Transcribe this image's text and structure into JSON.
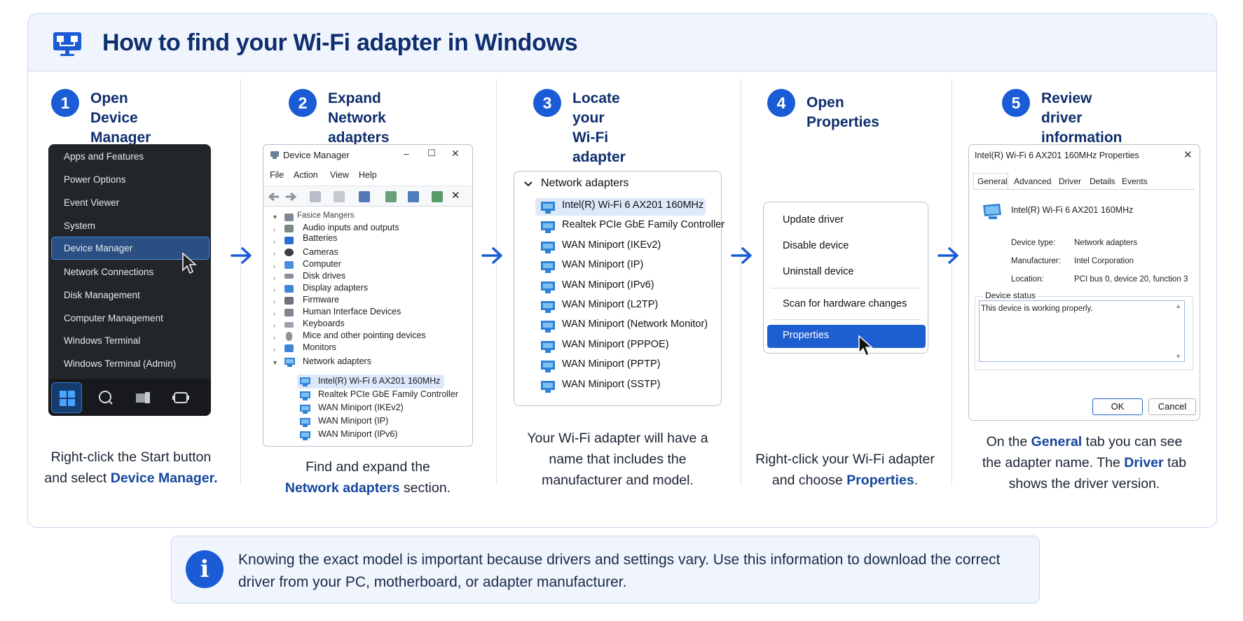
{
  "page": {
    "title": "How to find your Wi-Fi adapter in Windows",
    "icon": "monitor-network-icon"
  },
  "colors": {
    "accent": "#1a5bd6",
    "title": "#0f2e6e",
    "card_border": "#c6d8ef",
    "header_bg": "#f0f5fd"
  },
  "steps": [
    {
      "num": "1",
      "title": "Open Device\nManager"
    },
    {
      "num": "2",
      "title": "Expand Network\nadapters"
    },
    {
      "num": "3",
      "title": "Locate your Wi-Fi\nadapter"
    },
    {
      "num": "4",
      "title": "Open Properties"
    },
    {
      "num": "5",
      "title": "Review driver\ninformation"
    }
  ],
  "captions": {
    "s1_line1": "Right-click the Start button",
    "s1_line2a": "and select ",
    "s1_line2b": "Device Manager.",
    "s2_line1": "Find and expand the",
    "s2_line2a": "Network adapters",
    "s2_line2b": " section.",
    "s3_line1": "Your Wi-Fi adapter will have a",
    "s3_line2": "name that includes the",
    "s3_line3": "manufacturer and model.",
    "s4_line1": "Right-click your Wi-Fi adapter",
    "s4_line2a": "and choose ",
    "s4_line2b": "Properties",
    "s4_line2c": ".",
    "s5_line1a": "On the ",
    "s5_line1b": "General",
    "s5_line1c": " tab you can see",
    "s5_line2a": "the adapter name. The ",
    "s5_line2b": "Driver",
    "s5_line2c": " tab",
    "s5_line3": "shows the driver version."
  },
  "start_menu": {
    "items": [
      "Apps and Features",
      "Power Options",
      "Event Viewer",
      "System",
      "Device Manager",
      "Network Connections",
      "Disk Management",
      "Computer Management",
      "Windows Terminal",
      "Windows Terminal (Admin)"
    ],
    "selected": "Device Manager"
  },
  "device_manager": {
    "title": "Device Manager",
    "menu": [
      "File",
      "Action",
      "View",
      "Help"
    ],
    "window_controls": [
      "–",
      "☐",
      "✕"
    ],
    "tree": [
      "Fasice Mangers",
      "Audio inputs and outputs",
      "Batteries",
      "Cameras",
      "Computer",
      "Disk drives",
      "Display adapters",
      "Firmware",
      "Human Interface Devices",
      "Keyboards",
      "Mice and other pointing devices",
      "Monitors",
      "Network adapters"
    ],
    "network_children": [
      "Intel(R) Wi-Fi 6 AX201 160MHz",
      "Realtek PCIe GbE Family Controller",
      "WAN Miniport (IKEv2)",
      "WAN Miniport (IP)",
      "WAN Miniport (IPv6)"
    ]
  },
  "network_list": {
    "header": "Network adapters",
    "items": [
      "Intel(R) Wi-Fi 6 AX201 160MHz",
      "Realtek PCIe GbE Family Controller",
      "WAN Miniport (IKEv2)",
      "WAN Miniport (IP)",
      "WAN Miniport (IPv6)",
      "WAN Miniport (L2TP)",
      "WAN Miniport (Network Monitor)",
      "WAN Miniport (PPPOE)",
      "WAN Miniport (PPTP)",
      "WAN Miniport (SSTP)"
    ]
  },
  "context_menu": {
    "items": [
      "Update driver",
      "Disable device",
      "Uninstall device",
      "Scan for hardware changes",
      "Properties"
    ],
    "selected": "Properties"
  },
  "properties": {
    "title": "Intel(R) Wi-Fi 6 AX201 160MHz Properties",
    "tabs": [
      "General",
      "Advanced",
      "Driver",
      "Details",
      "Events"
    ],
    "active_tab": "General",
    "device_name": "Intel(R) Wi-Fi 6 AX201 160MHz",
    "fields": [
      {
        "label": "Device type:",
        "value": "Network adapters"
      },
      {
        "label": "Manufacturer:",
        "value": "Intel Corporation"
      },
      {
        "label": "Location:",
        "value": "PCI bus 0, device 20, function 3"
      }
    ],
    "status_label": "Device status",
    "status_text": "This device is working properly.",
    "ok": "OK",
    "cancel": "Cancel"
  },
  "info": {
    "icon": "info-icon",
    "text": "Knowing the exact model is important because drivers and settings vary. Use this information to download the correct driver from your PC, motherboard, or adapter manufacturer."
  }
}
